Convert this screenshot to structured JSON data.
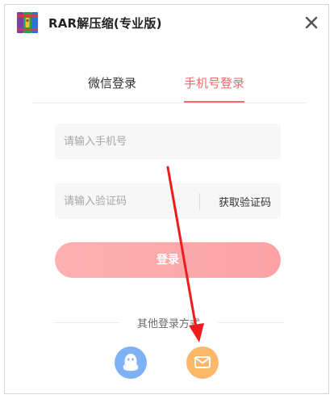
{
  "window": {
    "title": "RAR解压缩(专业版)",
    "close_icon": "close-icon",
    "app_icon": "winrar-books-icon"
  },
  "tabs": [
    {
      "label": "微信登录",
      "active": false
    },
    {
      "label": "手机号登录",
      "active": true
    }
  ],
  "form": {
    "phone_placeholder": "请输入手机号",
    "code_placeholder": "请输入验证码",
    "get_code_label": "获取验证码",
    "login_label": "登录"
  },
  "other_login": {
    "label": "其他登录方式",
    "methods": [
      {
        "icon": "qq-penguin-icon",
        "color": "#7fb1f7"
      },
      {
        "icon": "mail-envelope-icon",
        "color": "#fcb86a"
      }
    ]
  },
  "colors": {
    "accent": "#f3696a",
    "login_button": "#fca2a4",
    "annotation_arrow": "#ee1c1c"
  }
}
